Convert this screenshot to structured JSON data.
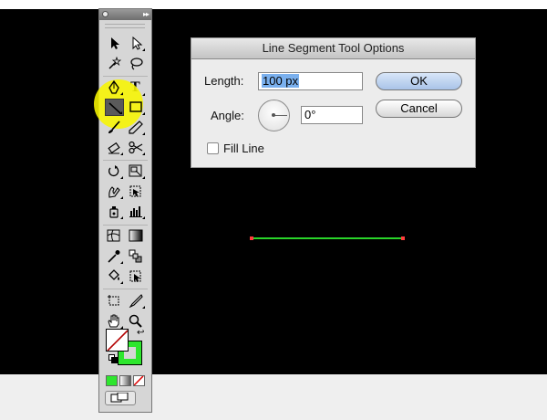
{
  "dialog": {
    "title": "Line Segment Tool Options",
    "length_label": "Length:",
    "length_value": "100 px",
    "angle_label": "Angle:",
    "angle_value": "0°",
    "fill_line_label": "Fill Line",
    "fill_line_checked": false,
    "ok_label": "OK",
    "cancel_label": "Cancel"
  },
  "toolbox": {
    "selected_tool": "line-segment-tool",
    "type_tool_glyph": "T",
    "fill_color": "#ffffff",
    "stroke_color": "#2ee62e"
  },
  "colors": {
    "canvas_background": "#000000",
    "drawn_line": "#29d429",
    "anchor_points": "#ff3d3d",
    "highlight": "#f8f600"
  }
}
